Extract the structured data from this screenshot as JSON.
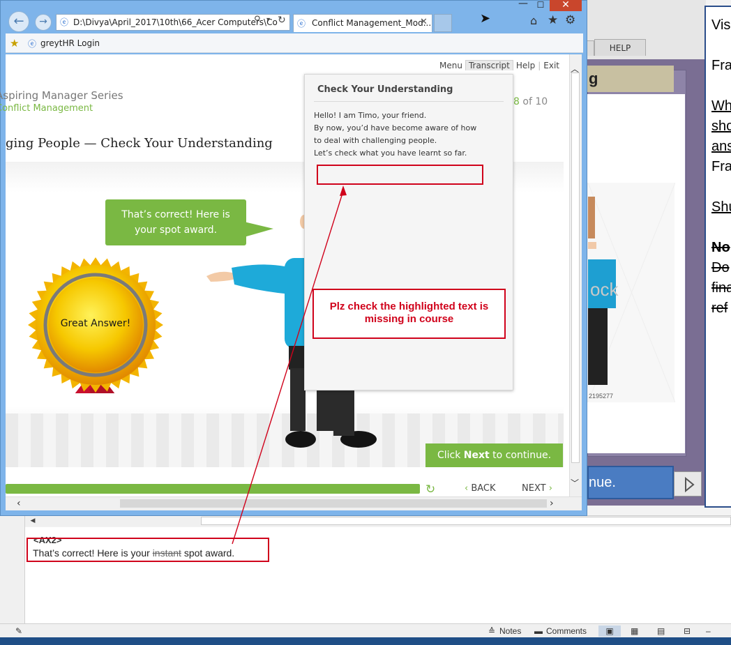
{
  "browser": {
    "address": "D:\\Divya\\April_2017\\10th\\66_Acer Computers\\Co",
    "tab_title": "Conflict Management_Mod...",
    "favorite_link": "greytHR Login",
    "controls": {
      "close": "✕",
      "minimize": "—",
      "maximize": "☐"
    }
  },
  "course": {
    "menu_items": [
      "Menu",
      "Transcript",
      "Help",
      "Exit"
    ],
    "series_title": "Aspiring Manager Series",
    "module_title": "Conflict Management",
    "page_heading": "ging People — Check Your Understanding",
    "page_counter": {
      "current": "8",
      "of_label": "of 10"
    },
    "speech_bubble": [
      "That’s correct! Here is",
      "your spot award."
    ],
    "award_label": "Great Answer!",
    "continue_banner": {
      "pre": "Click ",
      "bold": "Next",
      "post": " to continue."
    },
    "back_label": "BACK",
    "next_label": "NEXT",
    "progress": 1.0,
    "accent_color": "#7ab843"
  },
  "transcript": {
    "title": "Check Your Understanding",
    "lines": [
      "Hello! I am Timo, your friend.",
      "By now, you’d have become aware of how",
      "to deal with challenging people.",
      "Let’s check what you have learnt so far."
    ]
  },
  "annotation": {
    "text": "Plz check the highlighted text is missing in course",
    "color": "#d0021b"
  },
  "background_app": {
    "help_tab": "HELP",
    "slide_heading": "g",
    "stock_code": "2195277",
    "stock_mark": "ock",
    "continue_button": "nue.",
    "doc_lines": [
      "Vis",
      "",
      "Fra",
      "",
      "Wh",
      "sho",
      "ans",
      "Fra",
      "",
      "Shu",
      "",
      "No",
      "Do",
      "fina",
      "ref"
    ],
    "notes": {
      "tag": "<AX2>",
      "before": "That’s correct! Here is your ",
      "strike": "instant",
      "after": " spot award."
    },
    "statusbar": {
      "notes": "Notes",
      "comments": "Comments"
    }
  }
}
